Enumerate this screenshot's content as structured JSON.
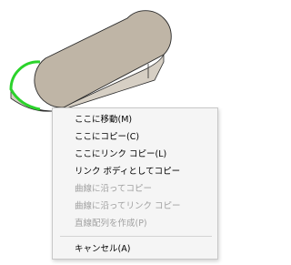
{
  "viewport": {
    "colors": {
      "background": "#ffffff",
      "face_top": "#bfb5a6",
      "face_side": "#d6cfc4",
      "edge": "#2a2a2a",
      "selected_edge": "#2bd32b"
    }
  },
  "context_menu": {
    "items": [
      {
        "label": "ここに移動(M)",
        "enabled": true
      },
      {
        "label": "ここにコピー(C)",
        "enabled": true
      },
      {
        "label": "ここにリンク コピー(L)",
        "enabled": true
      },
      {
        "label": "リンク ボディとしてコピー",
        "enabled": true
      },
      {
        "label": "曲線に沿ってコピー",
        "enabled": false
      },
      {
        "label": "曲線に沿ってリンク コピー",
        "enabled": false
      },
      {
        "label": "直線配列を作成(P)",
        "enabled": false
      }
    ],
    "cancel": {
      "label": "キャンセル(A)",
      "enabled": true
    }
  }
}
